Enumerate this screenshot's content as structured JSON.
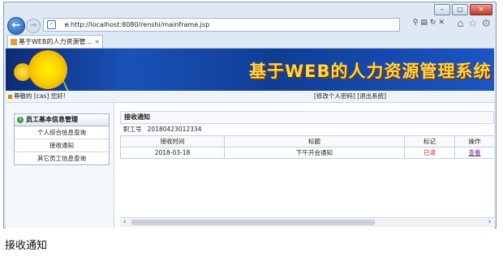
{
  "browser": {
    "url": "http://localhost:8080/renshi/mainframe.jsp",
    "url_host": "http://localhost",
    "url_rest": ":8080/renshi/mainframe.jsp",
    "tab_title": "基于WEB的人力资源管...",
    "window_controls": [
      "–",
      "□",
      "✕"
    ]
  },
  "banner": {
    "title": "基于WEB的人力资源管理系统"
  },
  "infobar": {
    "greeting": "尊敬的 [cas] 您好!",
    "links": "[修改个人密码] [退出系统]"
  },
  "sidebar": {
    "heading": "员工基本信息管理",
    "items": [
      {
        "label": "个人综合信息查询"
      },
      {
        "label": "接收通知"
      },
      {
        "label": "其它员工信息查询"
      }
    ]
  },
  "main": {
    "title": "接收通知",
    "employee_label": "职工号",
    "employee_id": "20180423012334",
    "columns": [
      "接收时间",
      "标题",
      "标记",
      "操作"
    ],
    "rows": [
      {
        "time": "2018-03-18",
        "title": "下午开会通知",
        "status": "已读",
        "action": "查看"
      }
    ]
  },
  "caption": "接收通知",
  "colors": {
    "banner": "#1a52b8",
    "banner_text": "#ffd54a",
    "status_read": "#d2232a",
    "link": "#5b2a8c"
  },
  "icons": [
    "back-arrow-icon",
    "forward-arrow-icon",
    "shield-icon",
    "search-icon",
    "refresh-icon",
    "home-icon",
    "star-icon",
    "gear-icon",
    "close-icon"
  ]
}
